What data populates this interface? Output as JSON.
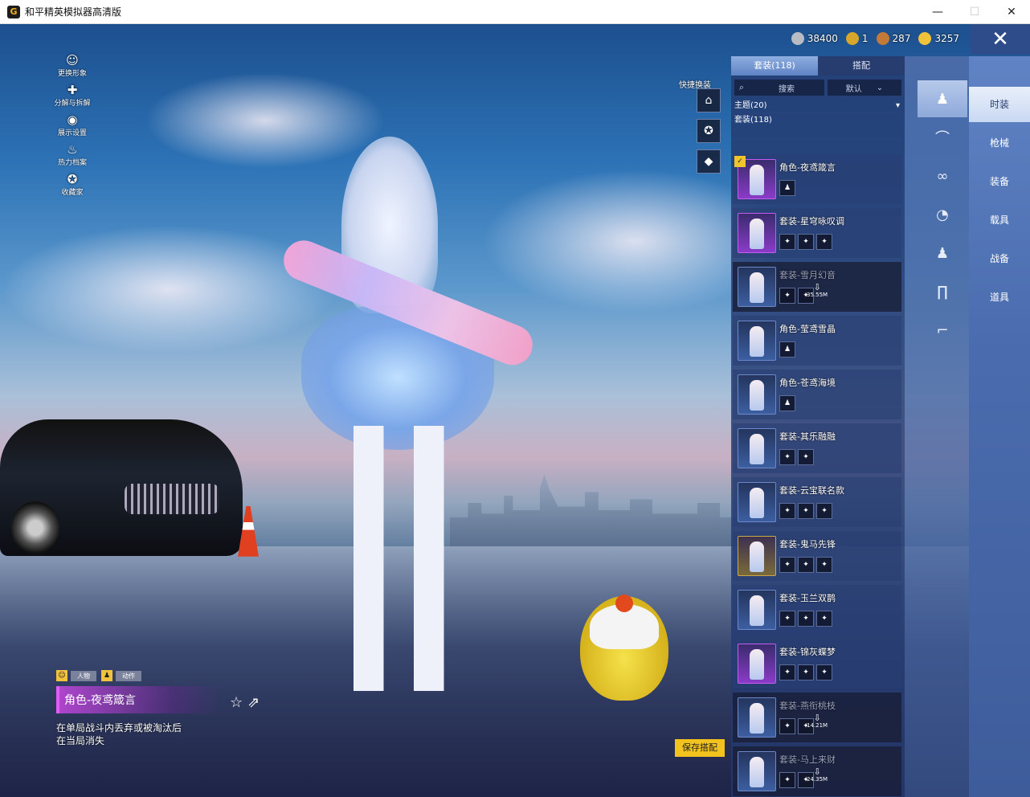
{
  "window": {
    "title": "和平精英模拟器高清版",
    "icon_glyph": "G",
    "minimize_icon": "minimize-icon",
    "maximize_icon": "maximize-icon",
    "close_icon": "close-icon"
  },
  "left_menu": [
    {
      "label": "更换形象",
      "icon": "avatar-icon",
      "glyph": "☺"
    },
    {
      "label": "分解与拆解",
      "icon": "puzzle-icon",
      "glyph": "✚"
    },
    {
      "label": "展示设置",
      "icon": "eye-icon",
      "glyph": "◉"
    },
    {
      "label": "热力档案",
      "icon": "flame-icon",
      "glyph": "♨"
    },
    {
      "label": "收藏家",
      "icon": "collector-icon",
      "glyph": "✪"
    }
  ],
  "currency": [
    {
      "value": "38400",
      "icon": "silver-coin-icon",
      "color": "#b9bcc4"
    },
    {
      "value": "1",
      "icon": "gold-medal-icon",
      "color": "#d8a62b"
    },
    {
      "value": "287",
      "icon": "bronze-coin-icon",
      "color": "#c47a37"
    },
    {
      "value": "3257",
      "icon": "gold-coin-icon",
      "color": "#f0c33a"
    }
  ],
  "quick_change": {
    "label": "快捷换装",
    "buttons": [
      "wardrobe-icon",
      "badge-icon",
      "diamond-icon"
    ]
  },
  "panel": {
    "tabs": [
      {
        "label": "套装(118)",
        "active": true
      },
      {
        "label": "搭配",
        "active": false
      }
    ],
    "search_placeholder": "搜索",
    "sort_label": "默认",
    "theme_label": "主题(20)",
    "set_label": "套装(118)"
  },
  "outfits": [
    {
      "name": "角色-夜鸢箴言",
      "thumb": "purple",
      "parts": [
        "♟"
      ],
      "selected": true,
      "downloading": false
    },
    {
      "name": "套装-星穹咏叹调",
      "thumb": "purple",
      "parts": [
        "✦",
        "✦",
        "✦"
      ],
      "downloading": false
    },
    {
      "name": "套装-雪月幻音",
      "thumb": "blue",
      "parts": [
        "✦",
        "✦"
      ],
      "downloading": true,
      "size": "35.55M"
    },
    {
      "name": "角色-莹鸢雪晶",
      "thumb": "blue",
      "parts": [
        "♟"
      ],
      "downloading": false
    },
    {
      "name": "角色-苍鸢海境",
      "thumb": "blue",
      "parts": [
        "♟"
      ],
      "downloading": false
    },
    {
      "name": "套装-其乐融融",
      "thumb": "blue",
      "parts": [
        "✦",
        "✦"
      ],
      "downloading": false
    },
    {
      "name": "套装-云宝联名款",
      "thumb": "blue",
      "parts": [
        "✦",
        "✦",
        "✦"
      ],
      "downloading": false
    },
    {
      "name": "套装-鬼马先锋",
      "thumb": "gold",
      "parts": [
        "✦",
        "✦",
        "✦"
      ],
      "downloading": false
    },
    {
      "name": "套装-玉兰双鹊",
      "thumb": "blue",
      "parts": [
        "✦",
        "✦",
        "✦"
      ],
      "downloading": false
    },
    {
      "name": "套装-锦灰蝶梦",
      "thumb": "purple",
      "parts": [
        "✦",
        "✦",
        "✦"
      ],
      "downloading": false
    },
    {
      "name": "套装-燕衔桃枝",
      "thumb": "blue",
      "parts": [
        "✦",
        "✦"
      ],
      "downloading": true,
      "size": "14.21M"
    },
    {
      "name": "套装-马上来财",
      "thumb": "blue",
      "parts": [
        "✦",
        "✦"
      ],
      "downloading": true,
      "size": "24.35M"
    }
  ],
  "rail": [
    {
      "icon": "full-body-icon",
      "glyph": "♟",
      "active": true
    },
    {
      "icon": "hat-icon",
      "glyph": "⌒"
    },
    {
      "icon": "glasses-icon",
      "glyph": "∞"
    },
    {
      "icon": "mask-icon",
      "glyph": "◔"
    },
    {
      "icon": "outfit-icon",
      "glyph": "♟"
    },
    {
      "icon": "pants-icon",
      "glyph": "∏"
    },
    {
      "icon": "shoes-icon",
      "glyph": "⌐"
    }
  ],
  "categories": [
    {
      "label": "时装",
      "active": true
    },
    {
      "label": "枪械"
    },
    {
      "label": "装备"
    },
    {
      "label": "载具"
    },
    {
      "label": "战备"
    },
    {
      "label": "道具"
    }
  ],
  "bottom": {
    "mode_person": "人物",
    "mode_action": "动作",
    "name": "角色-夜鸢箴言",
    "description": "在单局战斗内丢弃或被淘汰后在当局消失",
    "save_button": "保存搭配"
  },
  "close_game_icon": "close-icon"
}
